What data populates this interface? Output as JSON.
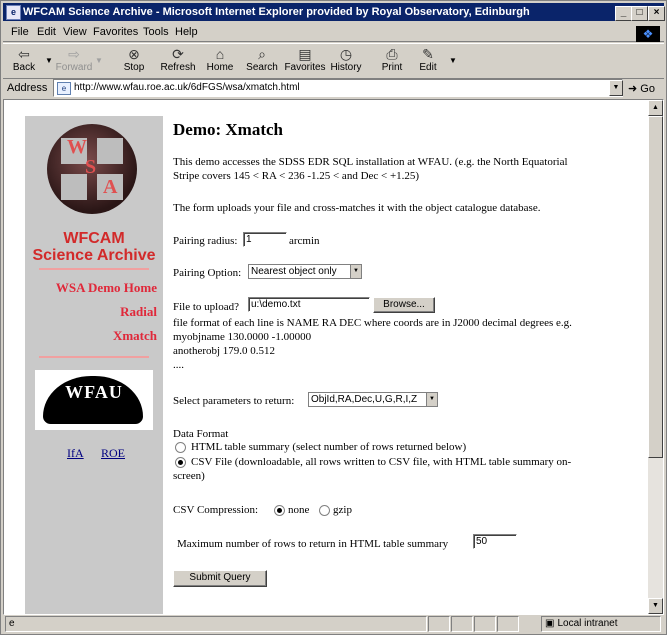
{
  "window": {
    "title": "WFCAM Science Archive - Microsoft Internet Explorer provided by Royal Observatory, Edinburgh",
    "controls": {
      "minimize": "_",
      "maximize": "□",
      "close": "×"
    }
  },
  "menu": [
    "File",
    "Edit",
    "View",
    "Favorites",
    "Tools",
    "Help"
  ],
  "toolbar": [
    {
      "label": "Back",
      "icon": "back-arrow-icon",
      "glyph": "⇦"
    },
    {
      "label": "Forward",
      "icon": "forward-arrow-icon",
      "glyph": "⇨"
    },
    {
      "label": "Stop",
      "icon": "stop-icon",
      "glyph": "⊗"
    },
    {
      "label": "Refresh",
      "icon": "refresh-icon",
      "glyph": "⟳"
    },
    {
      "label": "Home",
      "icon": "home-icon",
      "glyph": "⌂"
    },
    {
      "label": "Search",
      "icon": "search-icon",
      "glyph": "⌕"
    },
    {
      "label": "Favorites",
      "icon": "favorites-icon",
      "glyph": "▤"
    },
    {
      "label": "History",
      "icon": "history-icon",
      "glyph": "◷"
    },
    {
      "label": "Print",
      "icon": "print-icon",
      "glyph": "⎙"
    },
    {
      "label": "Edit",
      "icon": "edit-icon",
      "glyph": "✎"
    }
  ],
  "address": {
    "label": "Address",
    "url": "http://www.wfau.roe.ac.uk/6dFGS/wsa/xmatch.html",
    "go_label": "Go"
  },
  "sidebar": {
    "logo_letters": [
      "W",
      "S",
      "A"
    ],
    "title_line1": "WFCAM",
    "title_line2": "Science Archive",
    "links": [
      "WSA Demo Home",
      "Radial",
      "Xmatch"
    ],
    "wfau_logo_text": "WFAU",
    "external_links": [
      "IfA",
      "ROE"
    ]
  },
  "main": {
    "heading": "Demo: Xmatch",
    "intro_line1": "This demo accesses the SDSS EDR SQL installation at WFAU. (e.g. the North Equatorial",
    "intro_line2": "Stripe covers 145 < RA < 236 -1.25 < and Dec < +1.25)",
    "upload_desc": "The form uploads your file and cross-matches it with the object catalogue database.",
    "radius_label": "Pairing radius:",
    "radius_value": "1",
    "radius_unit": "arcmin",
    "option_label": "Pairing Option:",
    "option_value": "Nearest object only",
    "file_label": "File to upload?",
    "file_value": "u:\\demo.txt",
    "browse_label": "Browse...",
    "format_line": "file format of each line is NAME RA DEC where coords are in J2000 decimal degrees e.g.",
    "example1": "myobjname 130.0000 -1.00000",
    "example2": "anotherobj 179.0 0.512",
    "example3": "....",
    "params_label": "Select parameters to return:",
    "params_value": "ObjId,RA,Dec,U,G,R,I,Z",
    "data_format_label": "Data Format",
    "fmt_html": "HTML table summary (select number of rows returned below)",
    "fmt_csv_line1": "CSV File (downloadable, all rows written to CSV file, with HTML table summary on-",
    "fmt_csv_line2": "screen)",
    "compression_label": "CSV Compression:",
    "comp_none": "none",
    "comp_gzip": "gzip",
    "maxrows_label": "Maximum number of rows to return in HTML table summary",
    "maxrows_value": "50",
    "submit_label": "Submit Query"
  },
  "status": {
    "zone": "Local intranet"
  }
}
